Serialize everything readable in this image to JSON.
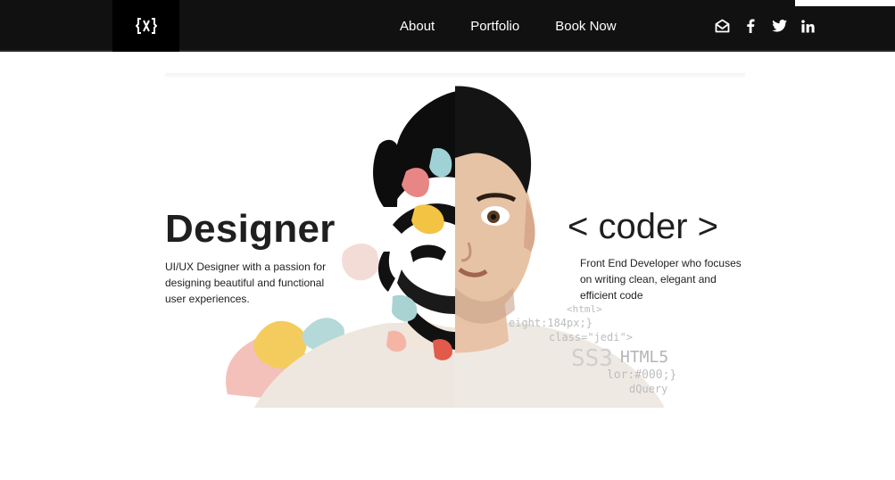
{
  "nav": {
    "logo_icon": "brackets-logo-icon",
    "links": [
      {
        "label": "About"
      },
      {
        "label": "Portfolio"
      },
      {
        "label": "Book Now"
      }
    ],
    "social_icons": [
      "envelope-open-icon",
      "facebook-icon",
      "twitter-icon",
      "linkedin-icon"
    ],
    "background": "#111111"
  },
  "hero": {
    "designer_title": "Designer",
    "designer_desc": "UI/UX Designer with a passion for designing beautiful and functional user experiences.",
    "coder_title": "< coder >",
    "coder_desc": "Front End Developer who focuses on writing clean, elegant and efficient code",
    "code_snippets": [
      "<html>",
      "eight:184px;}",
      "class=\"jedi\">",
      "SS3",
      "HTML5",
      "lor:#000;}",
      "dQuery"
    ]
  }
}
